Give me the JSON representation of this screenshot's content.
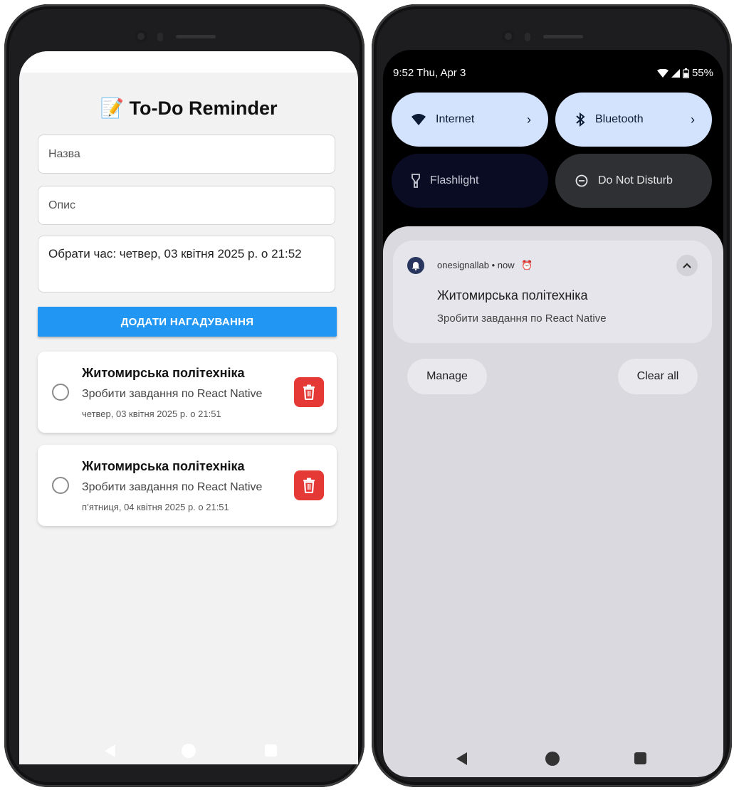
{
  "left_app": {
    "title": "📝 To-Do Reminder",
    "form": {
      "name_placeholder": "Назва",
      "desc_placeholder": "Опис",
      "time_label": "Обрати час: четвер, 03 квітня 2025 р. о 21:52",
      "add_button": "ДОДАТИ НАГАДУВАННЯ"
    },
    "reminders": [
      {
        "title": "Житомирська політехніка",
        "desc": "Зробити завдання по React Native",
        "date": "четвер, 03 квітня 2025 р. о 21:51"
      },
      {
        "title": "Житомирська політехніка",
        "desc": "Зробити завдання по React Native",
        "date": "п’ятниця, 04 квітня 2025 р. о 21:51"
      }
    ]
  },
  "right_shade": {
    "status": {
      "time_date": "9:52  Thu, Apr 3",
      "battery": "55%"
    },
    "tiles": [
      {
        "label": "Internet",
        "icon": "wifi-icon",
        "state": "on"
      },
      {
        "label": "Bluetooth",
        "icon": "bluetooth-icon",
        "state": "on"
      },
      {
        "label": "Flashlight",
        "icon": "flashlight-icon",
        "state": "off"
      },
      {
        "label": "Do Not Disturb",
        "icon": "do-not-disturb-icon",
        "state": "off"
      }
    ],
    "notification": {
      "meta": "onesignallab • now",
      "title": "Житомирська політехніка",
      "text": "Зробити завдання по React Native"
    },
    "manage_label": "Manage",
    "clear_all_label": "Clear all"
  },
  "colors": {
    "accent": "#2196f3",
    "delete": "#e53935",
    "tile_on": "#d3e3fd"
  }
}
